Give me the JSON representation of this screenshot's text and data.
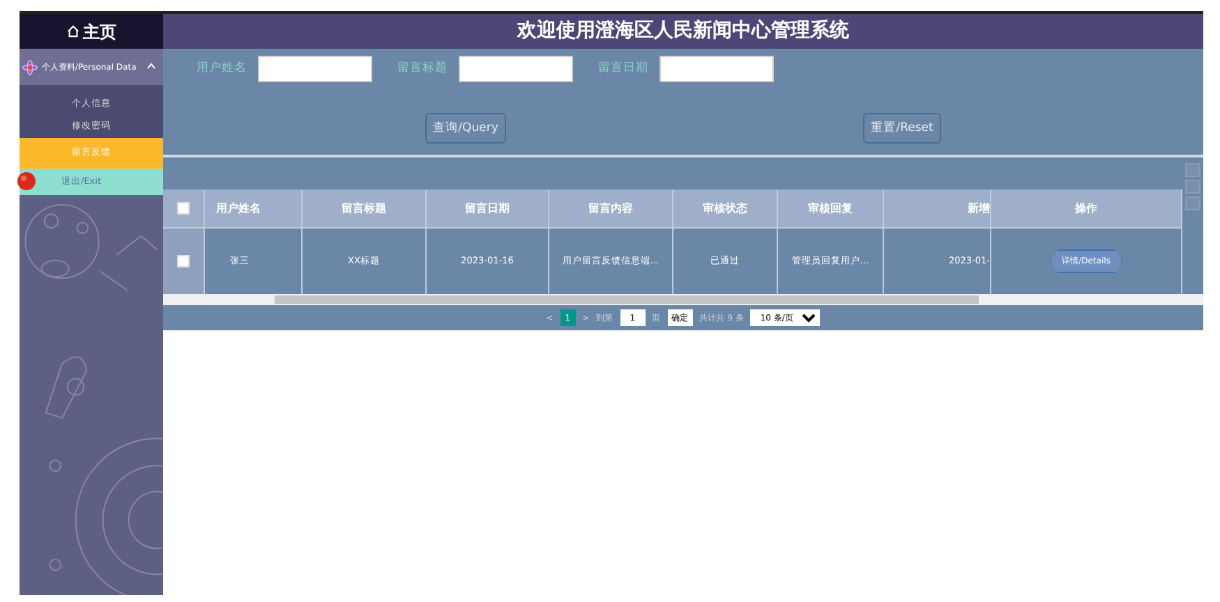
{
  "header": {
    "home": "主页",
    "title": "欢迎使用澄海区人民新闻中心管理系统"
  },
  "sidebar": {
    "group": {
      "label": "个人资料/Personal Data",
      "expanded": true,
      "children": [
        {
          "label": "个人信息",
          "selected": false
        },
        {
          "label": "修改密码",
          "selected": false
        },
        {
          "label": "留言反馈",
          "selected": true
        }
      ]
    },
    "exit": "退出/Exit"
  },
  "search": {
    "fields": [
      {
        "label": "用户姓名"
      },
      {
        "label": "留言标题"
      },
      {
        "label": "留言日期"
      }
    ],
    "buttons": [
      "查询/Query",
      "重置/Reset"
    ]
  },
  "table": {
    "all_checked": false,
    "columns": [
      "用户姓名",
      "留言标题",
      "留言日期",
      "留言内容",
      "审核状态",
      "审核回复",
      "新增",
      "操作"
    ],
    "rows": [
      {
        "checked": false,
        "cells": [
          "张三",
          "XX标题",
          "2023-01-16",
          "用户留言反馈信息端...",
          "已通过",
          "管理员回复用户...",
          "2023-01-"
        ],
        "action": "详情/Details"
      }
    ]
  },
  "pagination": {
    "prev": "<",
    "pages": [
      {
        "label": "1",
        "selected": true
      }
    ],
    "next": ">",
    "goto_label": "到第",
    "goto_value": "1",
    "page_suffix": "页",
    "confirm": "确定",
    "total": "共计共 9 条",
    "page_size": "10 条/页"
  }
}
